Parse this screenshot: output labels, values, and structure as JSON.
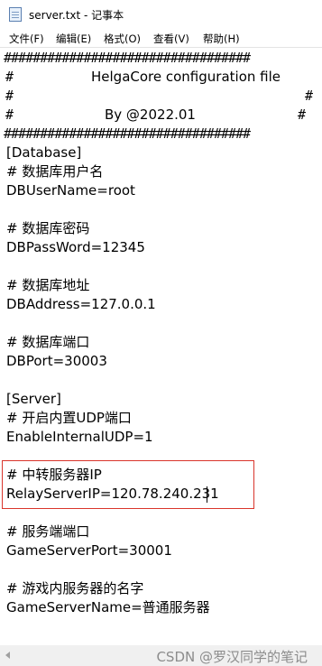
{
  "window": {
    "title": "server.txt - 记事本"
  },
  "menu": [
    {
      "label": "文件(F)"
    },
    {
      "label": "编辑(E)"
    },
    {
      "label": "格式(O)"
    },
    {
      "label": "查看(V)"
    },
    {
      "label": "帮助(H)"
    }
  ],
  "header": {
    "border_line": "##################################",
    "line2_title": "HelgaCore configuration file",
    "hash": "#",
    "line4_text": "By @2022.01"
  },
  "lines": [
    "[Database]",
    "# 数据库用户名",
    "DBUserName=root",
    "# 数据库密码",
    "DBPassWord=12345",
    "# 数据库地址",
    "DBAddress=127.0.0.1",
    "# 数据库端口",
    "DBPort=30003",
    "[Server]",
    "# 开启内置UDP端口",
    "EnableInternalUDP=1",
    "# 中转服务器IP",
    "RelayServerIP=120.78.240.231",
    "# 服务端端口",
    "GameServerPort=30001",
    "# 游戏内服务器的名字",
    "GameServerName=普通服务器"
  ],
  "watermark": "CSDN @罗汉同学的笔记"
}
